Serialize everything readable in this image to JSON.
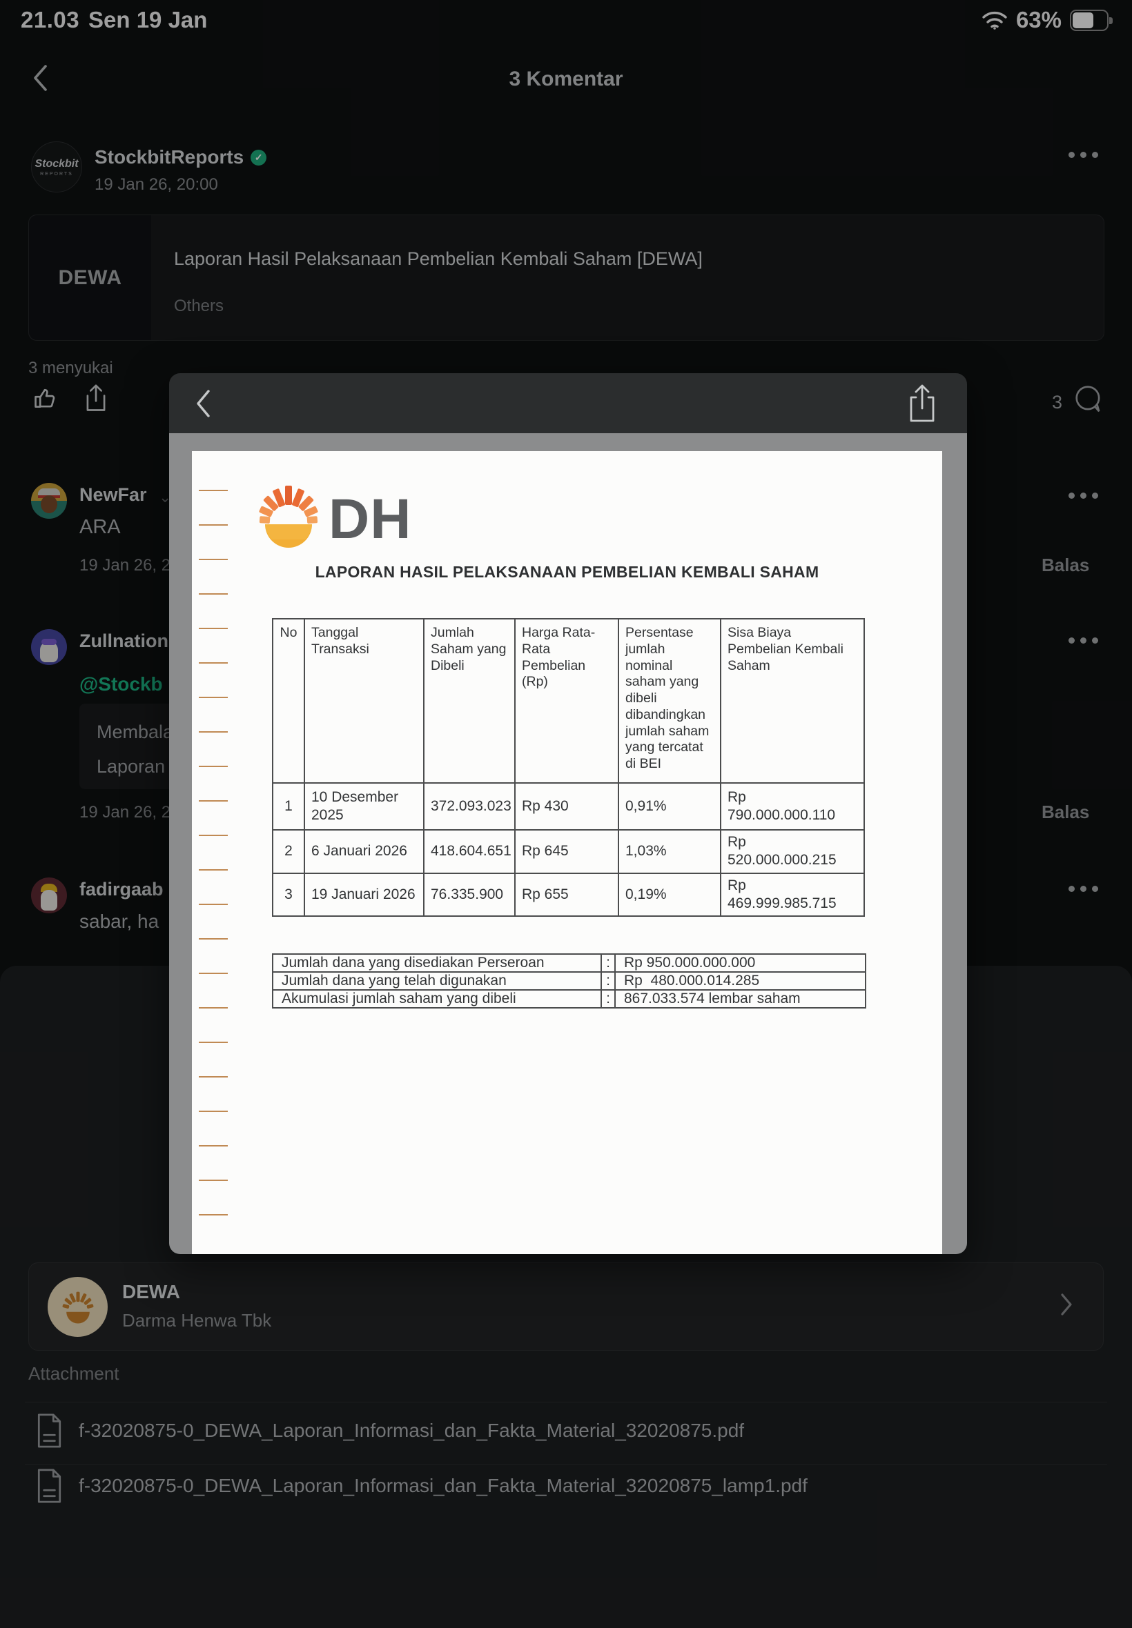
{
  "status_bar": {
    "time": "21.03",
    "date": "Sen 19 Jan",
    "battery_pct": "63%"
  },
  "header": {
    "title": "3 Komentar"
  },
  "post": {
    "author": "StockbitReports",
    "avatar_line1": "Stockbit",
    "avatar_line2": "REPORTS",
    "timestamp": "19 Jan 26, 20:00",
    "card": {
      "ticker": "DEWA",
      "title": "Laporan Hasil Pelaksanaan Pembelian Kembali Saham [DEWA]",
      "category": "Others"
    },
    "likes_label": "3 menyukai",
    "comment_count": "3"
  },
  "comments": [
    {
      "author": "NewFar",
      "text": "ARA",
      "timestamp": "19 Jan 26, 2",
      "reply_label": "Balas"
    },
    {
      "author": "Zullnation",
      "mention": "@Stockb",
      "quote_line1": "Membala",
      "quote_line2": "Laporan",
      "timestamp": "19 Jan 26, 2",
      "reply_label": "Balas"
    },
    {
      "author": "fadirgaab",
      "text": "sabar, ha"
    }
  ],
  "pdf_modal": {
    "document": {
      "logo_text": "DH",
      "title": "LAPORAN HASIL PELAKSANAAN PEMBELIAN KEMBALI SAHAM",
      "separator": ":",
      "table": {
        "headers": [
          "No",
          "Tanggal Transaksi",
          "Jumlah Saham yang Dibeli",
          "Harga Rata-Rata Pembelian (Rp)",
          "Persentase jumlah nominal saham yang dibeli dibandingkan jumlah saham yang tercatat di BEI",
          "Sisa Biaya Pembelian Kembali Saham"
        ],
        "rows": [
          [
            "1",
            "10 Desember 2025",
            "372.093.023",
            "Rp 430",
            "0,91%",
            "Rp 790.000.000.110"
          ],
          [
            "2",
            "6 Januari 2026",
            "418.604.651",
            "Rp 645",
            "1,03%",
            "Rp 520.000.000.215"
          ],
          [
            "3",
            "19 Januari 2026",
            "76.335.900",
            "Rp 655",
            "0,19%",
            "Rp  469.999.985.715"
          ]
        ]
      },
      "summary": [
        {
          "label": "Jumlah dana yang disediakan Perseroan",
          "value": "Rp 950.000.000.000"
        },
        {
          "label": "Jumlah dana yang telah digunakan",
          "value": "Rp  480.000.014.285"
        },
        {
          "label": "Akumulasi jumlah saham yang dibeli",
          "value": "867.033.574 lembar saham"
        }
      ]
    }
  },
  "company_card": {
    "ticker": "DEWA",
    "name": "Darma Henwa Tbk"
  },
  "attachments": {
    "label": "Attachment",
    "files": [
      "f-32020875-0_DEWA_Laporan_Informasi_dan_Fakta_Material_32020875.pdf",
      "f-32020875-0_DEWA_Laporan_Informasi_dan_Fakta_Material_32020875_lamp1.pdf"
    ]
  },
  "accent_colors": {
    "stockbit_green": "#1fae7d",
    "logo_orange": "#ed7c3c",
    "logo_yellow": "#f2ae35"
  }
}
